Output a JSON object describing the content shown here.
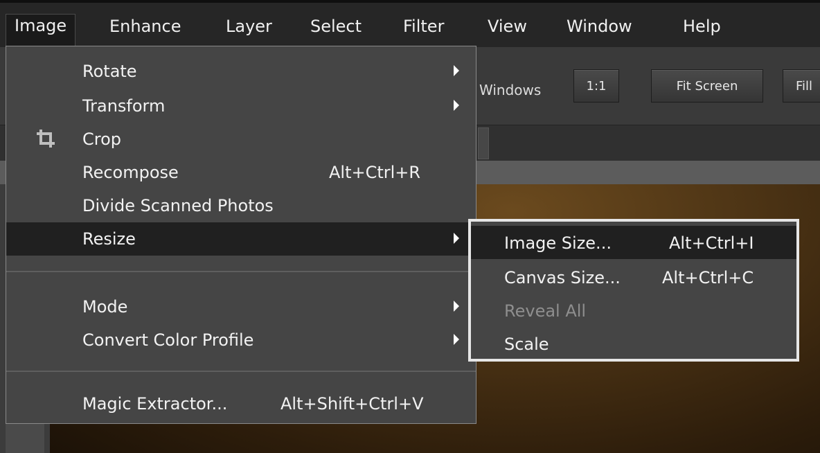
{
  "menubar": {
    "items": [
      "Image",
      "Enhance",
      "Layer",
      "Select",
      "Filter",
      "View",
      "Window",
      "Help"
    ]
  },
  "toolbar": {
    "windows_label": "Windows",
    "buttons": [
      "1:1",
      "Fit Screen",
      "Fill"
    ]
  },
  "image_menu": {
    "items": [
      {
        "label": "Rotate",
        "submenu": true
      },
      {
        "label": "Transform",
        "submenu": true
      },
      {
        "label": "Crop",
        "icon": "crop-icon"
      },
      {
        "label": "Recompose",
        "shortcut": "Alt+Ctrl+R"
      },
      {
        "label": "Divide Scanned Photos"
      },
      {
        "label": "Resize",
        "submenu": true,
        "highlighted": true
      },
      {
        "label": "Mode",
        "submenu": true
      },
      {
        "label": "Convert Color Profile",
        "submenu": true
      },
      {
        "label": "Magic Extractor...",
        "shortcut": "Alt+Shift+Ctrl+V"
      }
    ]
  },
  "resize_submenu": {
    "items": [
      {
        "label": "Image Size...",
        "shortcut": "Alt+Ctrl+I",
        "highlighted": true
      },
      {
        "label": "Canvas Size...",
        "shortcut": "Alt+Ctrl+C"
      },
      {
        "label": "Reveal All",
        "disabled": true
      },
      {
        "label": "Scale"
      }
    ]
  },
  "colors": {
    "menu_bg": "#454545",
    "highlight_bg": "#202020",
    "submenu_border": "#e6e6e6",
    "disabled_text": "#8e8e8e"
  }
}
